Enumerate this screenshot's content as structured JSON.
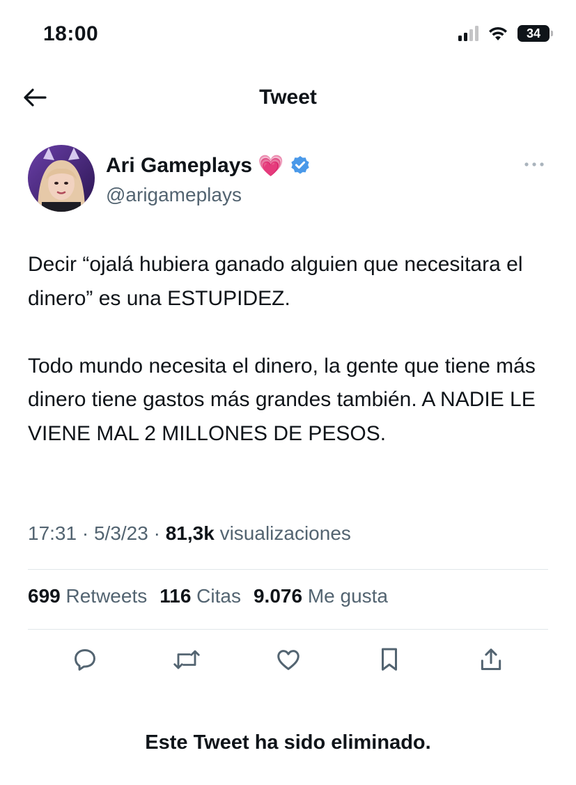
{
  "status_bar": {
    "time": "18:00",
    "battery": "34",
    "icons": [
      "signal-icon",
      "wifi-icon",
      "battery-icon"
    ]
  },
  "nav": {
    "title": "Tweet",
    "back_icon": "arrow-left-icon"
  },
  "tweet": {
    "author": {
      "display_name": "Ari Gameplays",
      "emoji": "💗",
      "handle": "@arigameplays",
      "verified": true,
      "verified_color": "#4a99e9"
    },
    "text": "Decir “ojalá hubiera ganado alguien que necesitara el dinero” es una ESTUPIDEZ.\n\nTodo mundo necesita el dinero, la gente que tiene más dinero tiene gastos más grandes también. A NADIE LE VIENE MAL 2 MILLONES DE PESOS.",
    "time": "17:31",
    "date": "5/3/23",
    "views_count": "81,3k",
    "views_label": "visualizaciones",
    "sep": "·"
  },
  "stats": {
    "retweets_count": "699",
    "retweets_label": "Retweets",
    "quotes_count": "116",
    "quotes_label": "Citas",
    "likes_count": "9.076",
    "likes_label": "Me gusta"
  },
  "actions": [
    "reply-icon",
    "retweet-icon",
    "like-icon",
    "bookmark-icon",
    "share-icon"
  ],
  "notice": "Este Tweet ha sido eliminado.",
  "colors": {
    "text": "#0f1419",
    "secondary": "#536471",
    "divider": "#e1e6ea"
  }
}
